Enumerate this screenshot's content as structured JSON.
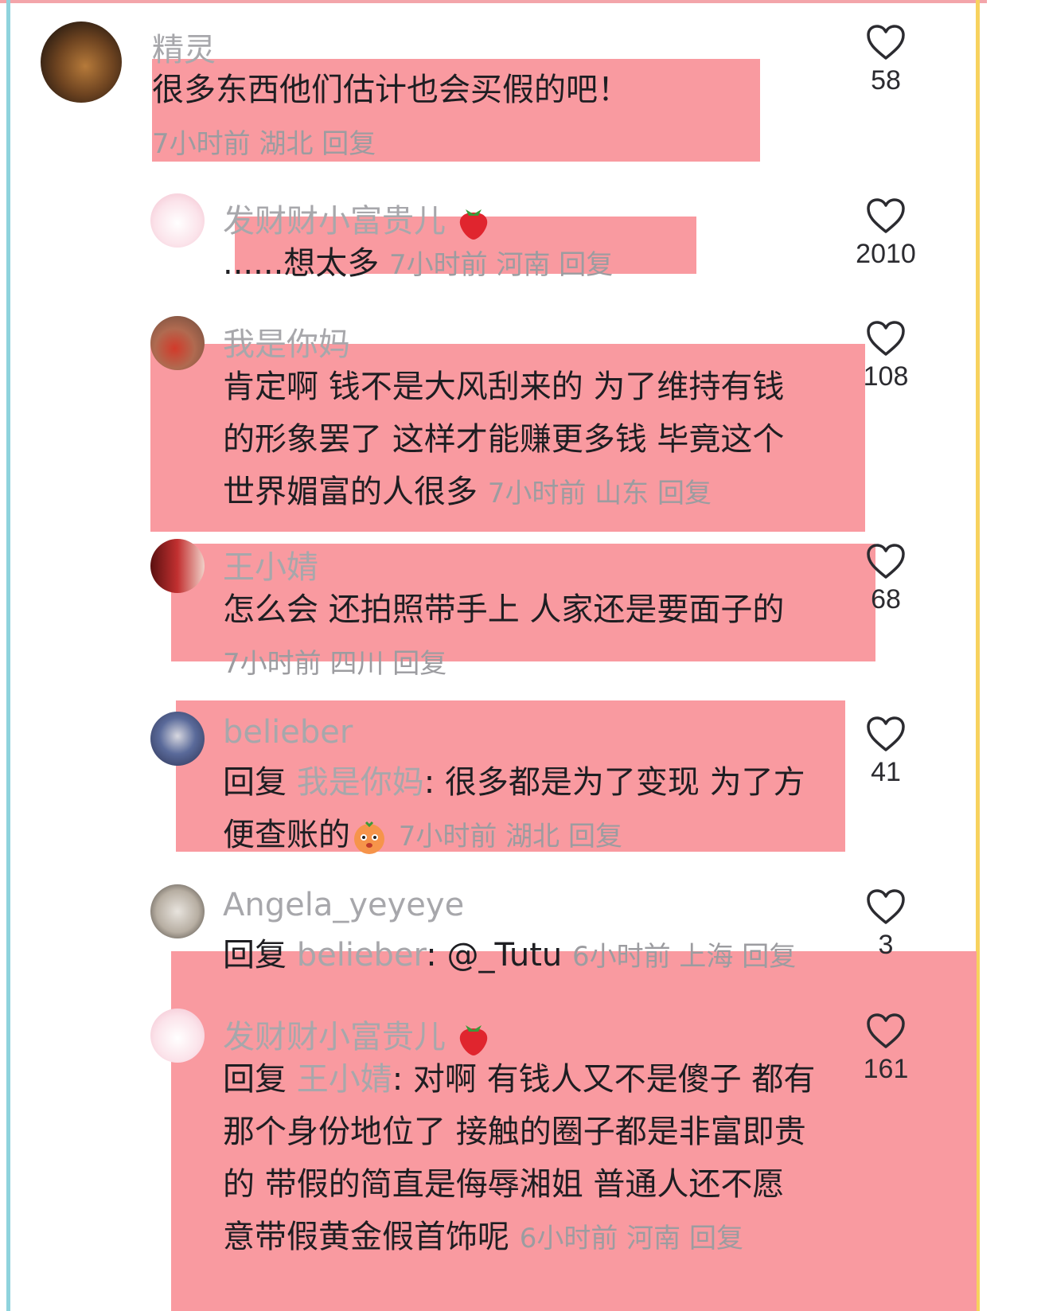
{
  "comments": [
    {
      "username": "精灵",
      "content": "很多东西他们估计也会买假的吧！",
      "time": "7小时前",
      "location": "湖北",
      "reply_label": "回复",
      "likes": "58"
    },
    {
      "username": "发财财小富贵儿",
      "emoji": "strawberry",
      "content": "......想太多",
      "time": "7小时前",
      "location": "河南",
      "reply_label": "回复",
      "likes": "2010"
    },
    {
      "username": "我是你妈",
      "content_lines": [
        "肯定啊 钱不是大风刮来的 为了维持有钱",
        "的形象罢了 这样才能赚更多钱 毕竟这个",
        "世界媚富的人很多"
      ],
      "time": "7小时前",
      "location": "山东",
      "reply_label": "回复",
      "likes": "108"
    },
    {
      "username": "王小婧",
      "content": "怎么会 还拍照带手上 人家还是要面子的",
      "time": "7小时前",
      "location": "四川",
      "reply_label": "回复",
      "likes": "68"
    },
    {
      "username": "belieber",
      "reply_prefix": "回复",
      "reply_to": "我是你妈",
      "content_lines": [
        ": 很多都是为了变现 为了方",
        "便查账的"
      ],
      "emoji": "orange-face",
      "time": "7小时前",
      "location": "湖北",
      "reply_label": "回复",
      "likes": "41"
    },
    {
      "username": "Angela_yeyeye",
      "reply_prefix": "回复",
      "reply_to": "belieber",
      "content": ": @_Tutu",
      "time": "6小时前",
      "location": "上海",
      "reply_label": "回复",
      "likes": "3"
    },
    {
      "username": "发财财小富贵儿",
      "emoji": "strawberry",
      "reply_prefix": "回复",
      "reply_to": "王小婧",
      "content_lines": [
        ": 对啊 有钱人又不是傻子 都有",
        "那个身份地位了 接触的圈子都是非富即贵",
        "的 带假的简直是侮辱湘姐  普通人还不愿",
        "意带假黄金假首饰呢"
      ],
      "time": "6小时前",
      "location": "河南",
      "reply_label": "回复",
      "likes": "161"
    }
  ],
  "colors": {
    "highlight": "#f99aa0",
    "frame_left": "#8fd3dd",
    "frame_right": "#f7d25e",
    "username": "#a7a7ab",
    "meta": "#9c9ca0"
  },
  "icons": {
    "like": "heart-outline-icon"
  }
}
